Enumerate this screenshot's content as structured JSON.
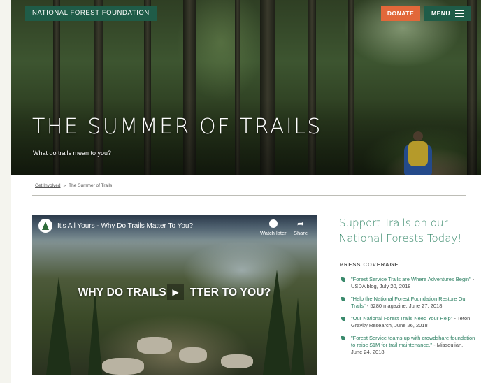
{
  "header": {
    "logo": "NATIONAL FOREST FOUNDATION",
    "donate_label": "DONATE",
    "menu_label": "MENU"
  },
  "hero": {
    "title": "THE SUMMER OF TRAILS",
    "subtitle": "What do trails mean to you?"
  },
  "breadcrumb": {
    "parent": "Get Involved",
    "separator": "»",
    "current": "The Summer of Trails"
  },
  "video": {
    "title": "It's All Yours - Why Do Trails Matter To You?",
    "watch_later": "Watch later",
    "share": "Share",
    "overlay_left": "WHY DO TRAILS",
    "overlay_right": "TTER TO YOU?",
    "play_glyph": "▶"
  },
  "sidebar": {
    "heading": "Support Trails on our National Forests Today!",
    "press_heading": "PRESS COVERAGE",
    "press": [
      {
        "quote": "\"Forest Service Trails are Where Adventures Begin\"",
        "source": " - USDA blog, July 20, 2018"
      },
      {
        "quote": "\"Help the National Forest Foundation Restore Our Trails\"",
        "source": " - 5280 magazine, June 27, 2018"
      },
      {
        "quote": "\"Our National Forest Trails Need Your Help\"",
        "source": " - Teton Gravity Research, June 26, 2018"
      },
      {
        "quote": "\"Forest Service teams up with crowdshare foundation to raise $1M for trail maintenance.\"",
        "source": " - Missoulian, June 24, 2018"
      }
    ]
  },
  "colors": {
    "brand_green": "#1f5c48",
    "donate_orange": "#e2683a",
    "accent_green": "#3a8a6c"
  }
}
